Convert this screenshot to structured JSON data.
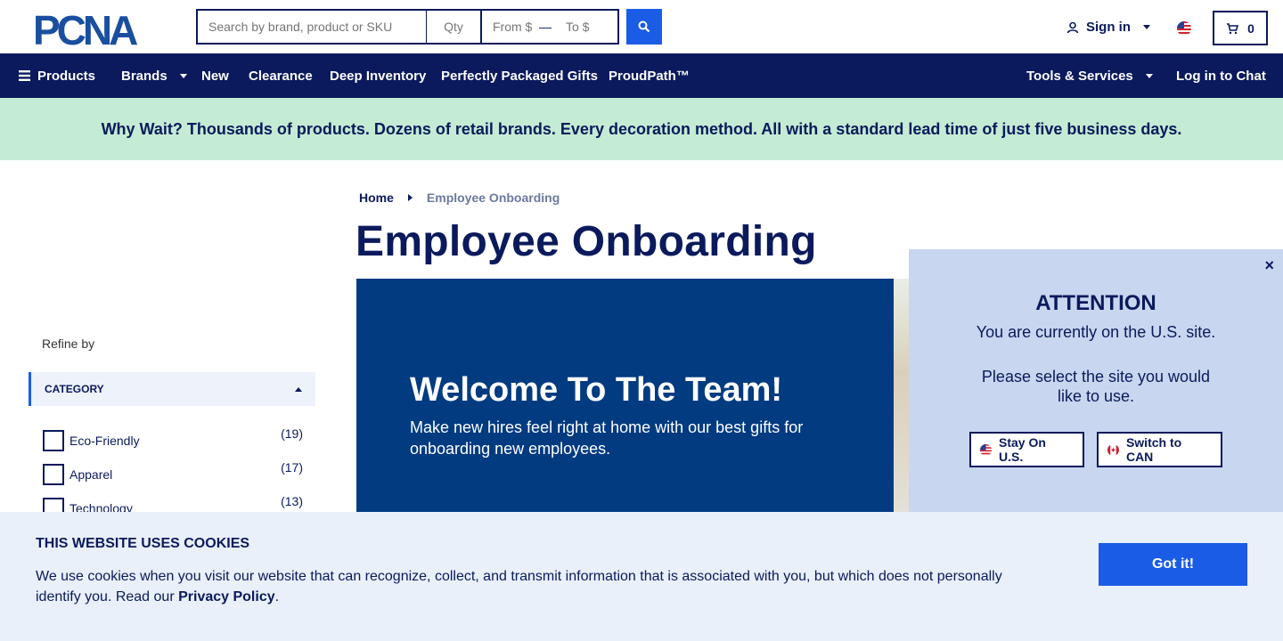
{
  "header": {
    "logo_text": "PCNA",
    "search_placeholder": "Search by brand, product or SKU",
    "qty_placeholder": "Qty",
    "price_from_placeholder": "From $",
    "price_to_placeholder": "To $",
    "signin_label": "Sign in",
    "cart_count": "0"
  },
  "nav": {
    "products": "Products",
    "brands": "Brands",
    "new": "New",
    "clearance": "Clearance",
    "deep_inventory": "Deep Inventory",
    "gifts": "Perfectly Packaged Gifts",
    "proudpath": "ProudPath™",
    "tools": "Tools & Services",
    "chat": "Log in to Chat"
  },
  "promo": {
    "text": "Why Wait? Thousands of products. Dozens of retail brands. Every decoration method. All with a standard lead time of just five business days."
  },
  "breadcrumb": {
    "home": "Home",
    "current": "Employee Onboarding"
  },
  "page": {
    "title": "Employee Onboarding"
  },
  "sidebar": {
    "refine_label": "Refine by",
    "category_header": "CATEGORY",
    "categories": [
      {
        "label": "Eco-Friendly",
        "count": "(19)"
      },
      {
        "label": "Apparel",
        "count": "(17)"
      },
      {
        "label": "Technology",
        "count": "(13)"
      }
    ]
  },
  "hero": {
    "title": "Welcome To The Team!",
    "subtitle": "Make new hires feel right at home with our best gifts for onboarding new employees."
  },
  "popup": {
    "close": "×",
    "title": "ATTENTION",
    "line1": "You are currently on the U.S. site.",
    "line2": "Please select the site you would like to use.",
    "stay_label": "Stay On U.S.",
    "switch_label": "Switch to CAN"
  },
  "cookie": {
    "title": "THIS WEBSITE USES COOKIES",
    "text": "We use cookies when you visit our website that can recognize, collect, and transmit information that is associated with you, but which does not personally identify you. Read our ",
    "link": "Privacy Policy",
    "period": ".",
    "button": "Got it!"
  },
  "colors": {
    "navy": "#0a1a5c",
    "blue": "#1a5ce6",
    "promo_bg": "#c4ecd4",
    "hero_bg": "#023b80",
    "popup_bg": "#c8d6ef",
    "cookie_bg": "#e9f0fa"
  }
}
